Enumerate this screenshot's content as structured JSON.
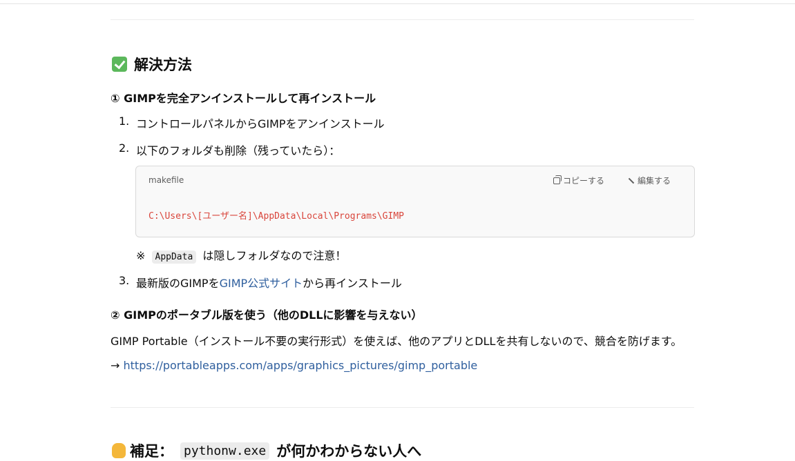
{
  "section1": {
    "heading": "解決方法",
    "sub1": {
      "title": "① GIMPを完全アンインストールして再インストール",
      "items": [
        {
          "num": "1.",
          "text": "コントロールパネルからGIMPをアンインストール"
        },
        {
          "num": "2.",
          "text": "以下のフォルダも削除（残っていたら）："
        }
      ],
      "code": {
        "lang": "makefile",
        "copy_label": "コピーする",
        "edit_label": "編集する",
        "content": "C:\\Users\\[ユーザー名]\\AppData\\Local\\Programs\\GIMP"
      },
      "note_prefix": "※",
      "note_code": "AppData",
      "note_suffix": "は隠しフォルダなので注意！",
      "item3": {
        "num": "3.",
        "pre": "最新版のGIMPを",
        "link": "GIMP公式サイト",
        "post": "から再インストール"
      }
    },
    "sub2": {
      "title": "② GIMPのポータブル版を使う（他のDLLに影響を与えない）",
      "desc": "GIMP Portable（インストール不要の実行形式）を使えば、他のアプリとDLLを共有しないので、競合を防げます。",
      "arrow": "→",
      "link": "https://portableapps.com/apps/graphics_pictures/gimp_portable"
    }
  },
  "section2": {
    "heading_pre": "補足：",
    "heading_code": "pythonw.exe",
    "heading_post": "が何かわからない人へ"
  }
}
